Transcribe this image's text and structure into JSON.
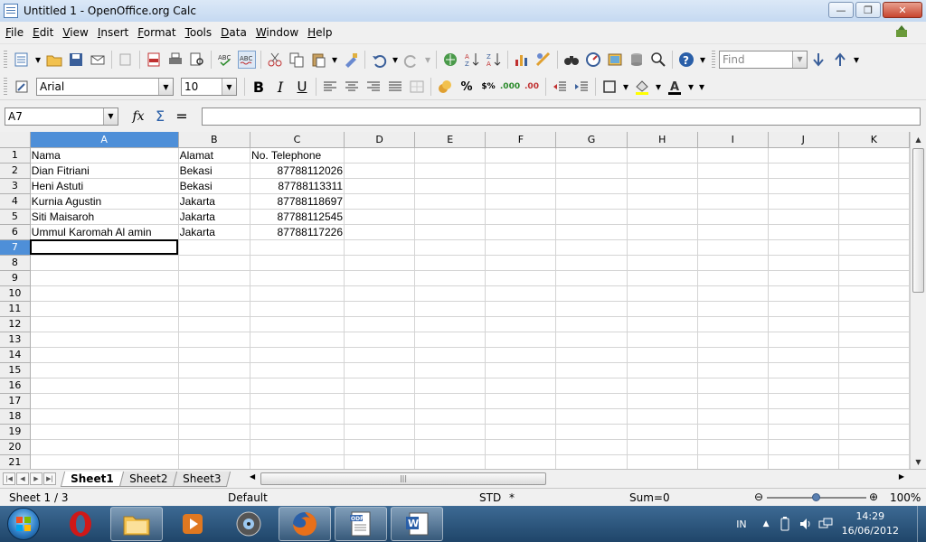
{
  "window": {
    "title": "Untitled 1 - OpenOffice.org Calc"
  },
  "menu": [
    "File",
    "Edit",
    "View",
    "Insert",
    "Format",
    "Tools",
    "Data",
    "Window",
    "Help"
  ],
  "toolbar": {
    "find_placeholder": "Find"
  },
  "format": {
    "font_name": "Arial",
    "font_size": "10"
  },
  "formula_bar": {
    "cell_ref": "A7",
    "formula": ""
  },
  "sheet": {
    "columns": [
      "A",
      "B",
      "C",
      "D",
      "E",
      "F",
      "G",
      "H",
      "I",
      "J",
      "K"
    ],
    "rows": [
      [
        "Nama",
        "Alamat",
        "No. Telephone"
      ],
      [
        "Dian Fitriani",
        "Bekasi",
        "87788112026"
      ],
      [
        "Heni Astuti",
        "Bekasi",
        "87788113311"
      ],
      [
        "Kurnia Agustin",
        "Jakarta",
        "87788118697"
      ],
      [
        "Siti Maisaroh",
        "Jakarta",
        "87788112545"
      ],
      [
        "Ummul Karomah Al amin",
        "Jakarta",
        "87788117226"
      ]
    ],
    "visible_row_count": 21,
    "active_cell": "A7"
  },
  "tabs": [
    "Sheet1",
    "Sheet2",
    "Sheet3"
  ],
  "active_tab": "Sheet1",
  "status": {
    "sheet": "Sheet 1 / 3",
    "style": "Default",
    "mode": "STD",
    "modified": "*",
    "sum": "Sum=0",
    "zoom": "100%"
  },
  "taskbar": {
    "lang": "IN",
    "time": "14:29",
    "date": "16/06/2012"
  },
  "colors": {
    "selection_header": "#4e8fd8",
    "taskbar": "#2a5580"
  }
}
